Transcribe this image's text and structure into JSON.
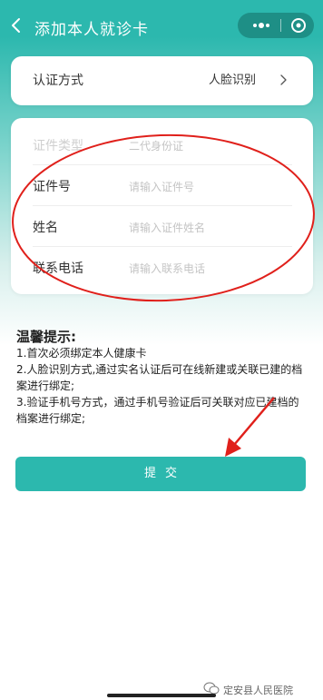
{
  "nav": {
    "title": "添加本人就诊卡"
  },
  "auth_row": {
    "label": "认证方式",
    "value": "人脸识别"
  },
  "form": {
    "id_type": {
      "label": "证件类型",
      "value": "二代身份证"
    },
    "id_number": {
      "label": "证件号",
      "placeholder": "请输入证件号"
    },
    "name": {
      "label": "姓名",
      "placeholder": "请输入证件姓名"
    },
    "phone": {
      "label": "联系电话",
      "placeholder": "请输入联系电话"
    }
  },
  "tips": {
    "title": "温馨提示:",
    "items": [
      "1.首次必须绑定本人健康卡",
      "2.人脸识别方式,通过实名认证后可在线新建或关联已建的档案进行绑定;",
      "3.验证手机号方式，通过手机号验证后可关联对应已建档的档案进行绑定;"
    ]
  },
  "submit": {
    "label": "提交"
  },
  "watermark": {
    "text": "定安县人民医院"
  },
  "colors": {
    "primary": "#2cb8ae",
    "capsule": "#1e8f86",
    "annotation": "#e0201b"
  },
  "icons": {
    "back": "chevron-left-icon",
    "more": "more-dots-icon",
    "close": "mini-program-close-icon",
    "chevron": "chevron-right-icon"
  }
}
